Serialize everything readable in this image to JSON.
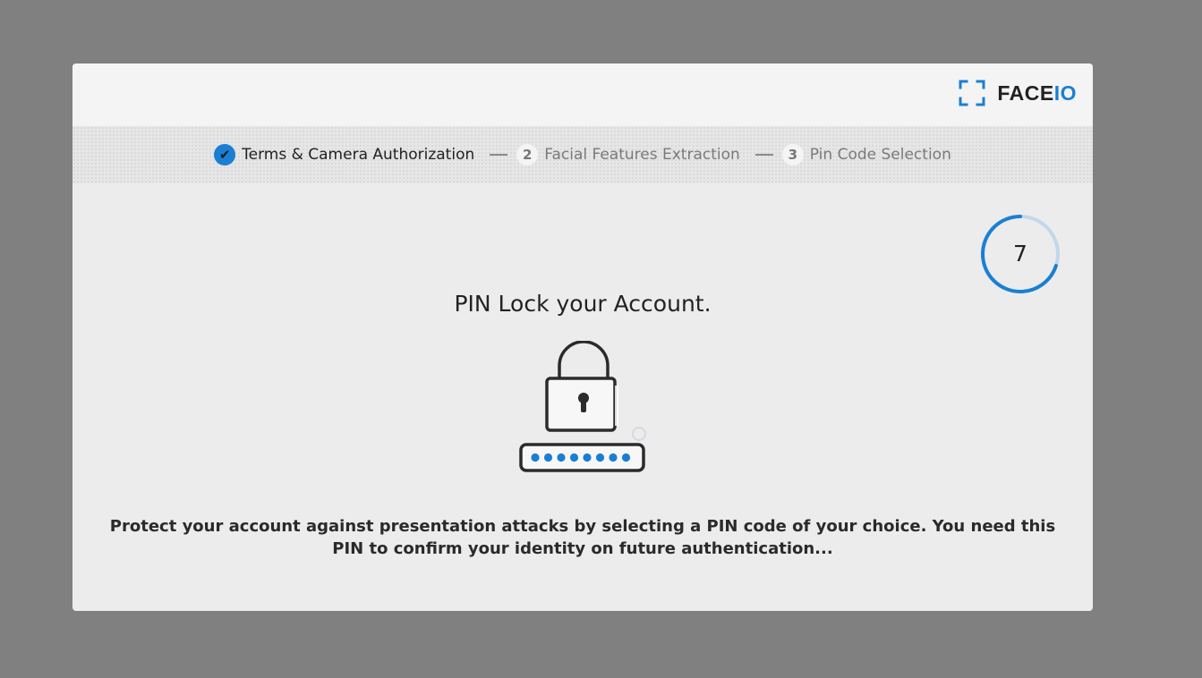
{
  "brand": {
    "logo_prefix": "FACE",
    "logo_accent": "IO",
    "accent_color": "#1a7fd4"
  },
  "stepper": {
    "steps": [
      {
        "badge": "✔",
        "label": "Terms & Camera Authorization",
        "state": "completed"
      },
      {
        "badge": "2",
        "label": "Facial Features Extraction",
        "state": "pending"
      },
      {
        "badge": "3",
        "label": "Pin Code Selection",
        "state": "pending"
      }
    ]
  },
  "timer": {
    "value": "7",
    "progress_fraction": 0.7
  },
  "content": {
    "title": "PIN Lock your Account.",
    "illustration_icon": "padlock-pin-icon",
    "pin_dot_count": 8,
    "description": "Protect your account against presentation attacks by selecting a PIN code of your choice. You need this PIN to confirm your identity on future authentication..."
  }
}
